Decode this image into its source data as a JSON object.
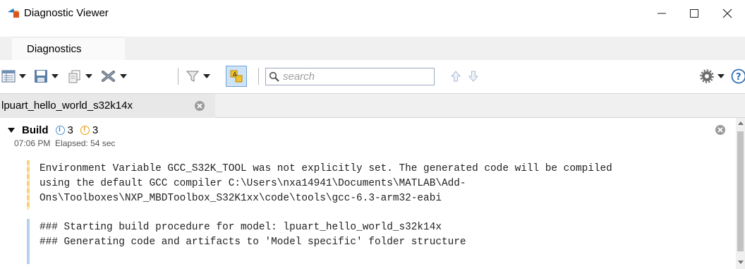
{
  "window": {
    "title": "Diagnostic Viewer",
    "app_icon": "matlab-simulink-icon",
    "controls": {
      "minimize": "minimize-icon",
      "maximize": "maximize-icon",
      "close": "close-icon"
    }
  },
  "tabs": [
    {
      "label": "Diagnostics",
      "active": true
    }
  ],
  "toolbar": {
    "buttons": [
      {
        "name": "view-layout-button",
        "icon": "layout-icon",
        "has_dropdown": true
      },
      {
        "name": "save-button",
        "icon": "save-icon",
        "has_dropdown": true
      },
      {
        "name": "copy-button",
        "icon": "copy-icon",
        "has_dropdown": true
      },
      {
        "name": "clear-button",
        "icon": "clear-icon",
        "has_dropdown": true
      },
      {
        "name": "filter-button",
        "icon": "filter-icon",
        "has_dropdown": true
      },
      {
        "name": "group-by-button",
        "icon": "group-icon",
        "has_dropdown": false
      },
      {
        "name": "previous-button",
        "icon": "arrow-up-icon",
        "has_dropdown": false
      },
      {
        "name": "next-button",
        "icon": "arrow-down-icon",
        "has_dropdown": false
      },
      {
        "name": "settings-button",
        "icon": "gear-icon",
        "has_dropdown": true
      },
      {
        "name": "help-button",
        "icon": "help-icon",
        "has_dropdown": false
      }
    ],
    "search": {
      "placeholder": "search",
      "value": ""
    }
  },
  "model_tab": {
    "label": "lpuart_hello_world_s32k14x"
  },
  "build": {
    "label": "Build",
    "info_count": "3",
    "warning_count": "3",
    "time": "07:06 PM",
    "elapsed": "Elapsed: 54 sec",
    "messages": [
      {
        "type": "warning",
        "lines": [
          "Environment Variable GCC_S32K_TOOL was not explicitly set. The generated code will be compiled",
          "using the default GCC compiler C:\\Users\\nxa14941\\Documents\\MATLAB\\Add-",
          "Ons\\Toolboxes\\NXP_MBDToolbox_S32K1xx\\code\\tools\\gcc-6.3-arm32-eabi"
        ]
      },
      {
        "type": "info",
        "lines": [
          "### Starting build procedure for model: lpuart_hello_world_s32k14x",
          "### Generating code and artifacts to 'Model specific' folder structure"
        ]
      }
    ]
  },
  "colors": {
    "info": "#4a8fd6",
    "warning": "#e8a400",
    "tab_strip": "#f0f0f0"
  }
}
